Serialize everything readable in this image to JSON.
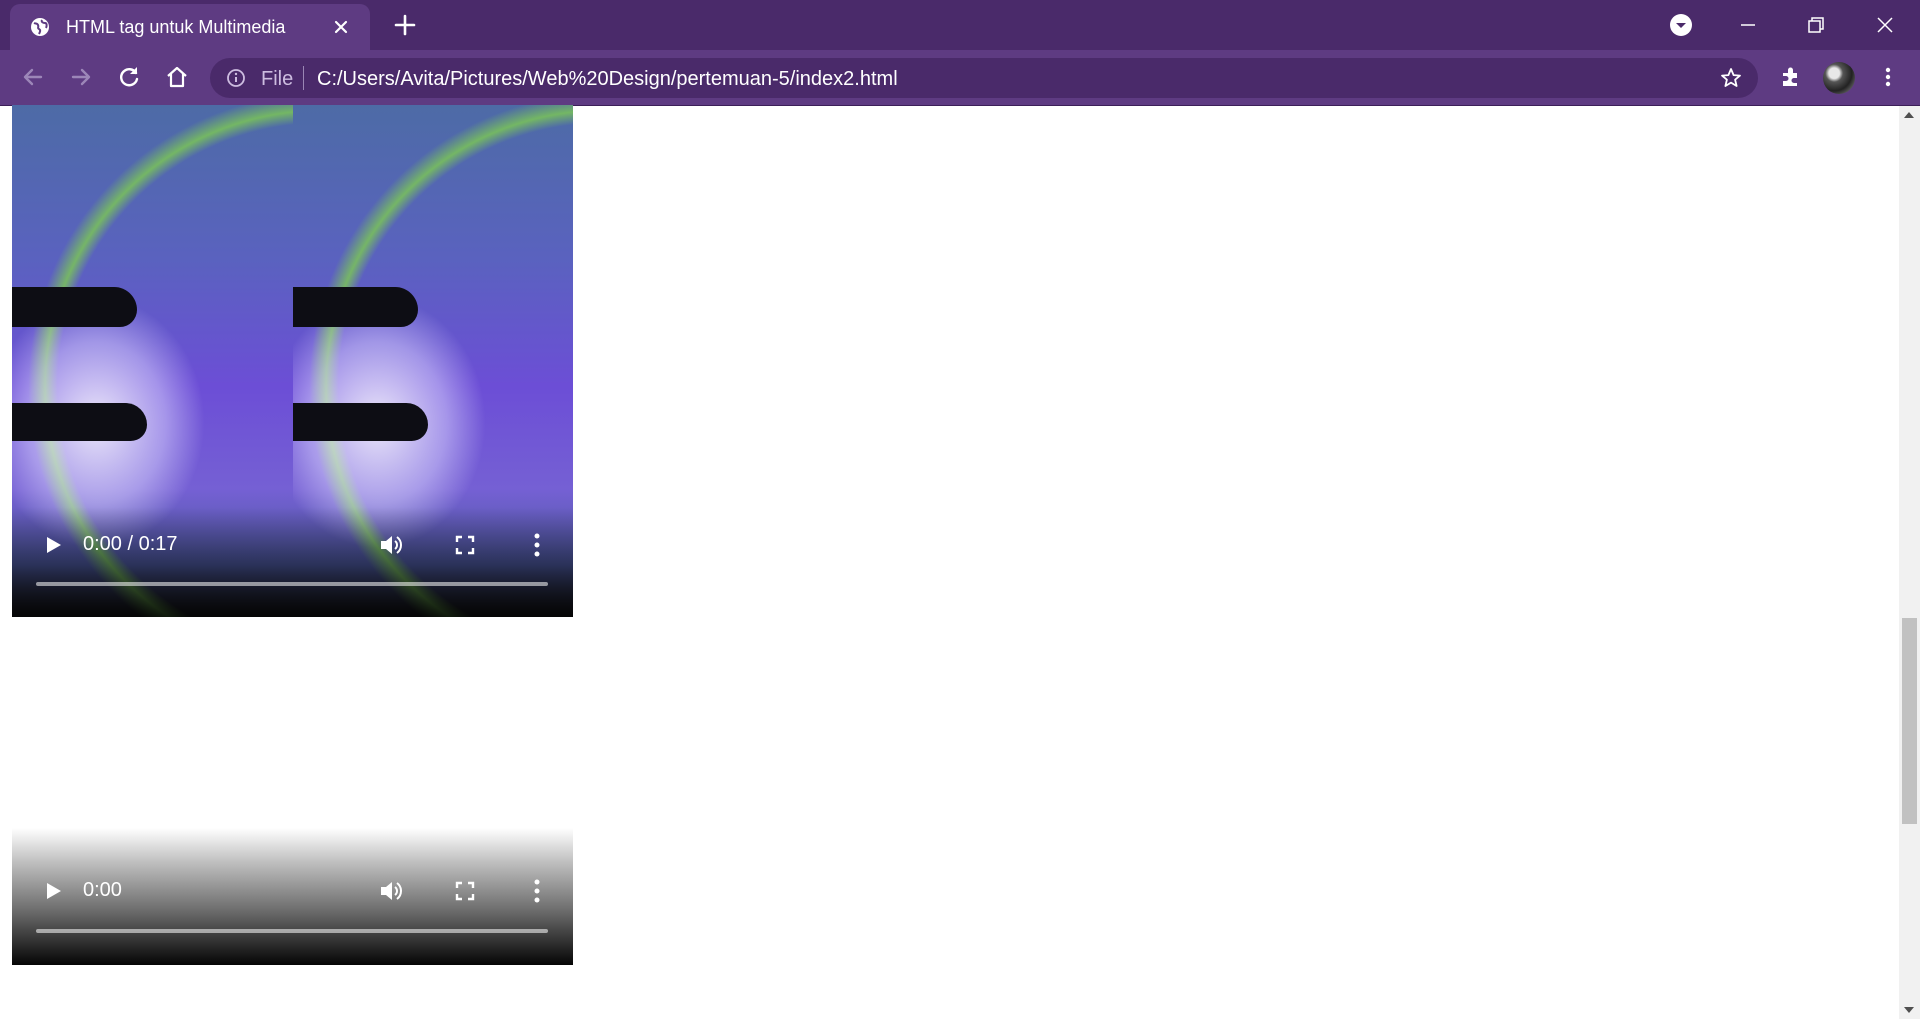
{
  "browser": {
    "tab_title": "HTML tag untuk Multimedia",
    "address_scheme": "File",
    "address_url": "C:/Users/Avita/Pictures/Web%20Design/pertemuan-5/index2.html",
    "icons": {
      "tab": "globe-icon",
      "close": "close-icon",
      "new_tab": "plus-icon",
      "back": "arrow-left-icon",
      "forward": "arrow-right-icon",
      "reload": "reload-icon",
      "home": "home-icon",
      "info": "info-icon",
      "bookmark": "star-icon",
      "extensions": "puzzle-icon",
      "menu": "kebab-icon"
    },
    "colors": {
      "tabbar": "#4a2a6a",
      "toolbar": "#5e3b82"
    }
  },
  "page": {
    "video1": {
      "time": "0:00 / 0:17",
      "progress": 0
    },
    "video2": {
      "time": "0:00",
      "progress": 0
    }
  }
}
